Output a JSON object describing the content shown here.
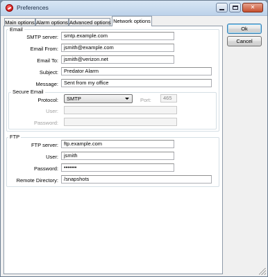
{
  "window": {
    "title": "Preferences"
  },
  "tabs": [
    "Main options",
    "Alarm options",
    "Advanced options",
    "Network options"
  ],
  "buttons": {
    "ok": "Ok",
    "cancel": "Cancel"
  },
  "email": {
    "group_label": "Email",
    "smtp_server_label": "SMTP server:",
    "smtp_server_value": "smtp.example.com",
    "email_from_label": "Email From:",
    "email_from_value": "jsmith@example.com",
    "email_to_label": "Email To:",
    "email_to_value": "jsmith@verizon.net",
    "subject_label": "Subject:",
    "subject_value": "Predator Alarm",
    "message_label": "Message:",
    "message_value": "Sent from my office"
  },
  "secure_email": {
    "group_label": "Secure Email",
    "protocol_label": "Protocol:",
    "protocol_value": "SMTP",
    "port_label": "Port:",
    "port_value": "465",
    "user_label": "User:",
    "user_value": "",
    "password_label": "Password:",
    "password_value": ""
  },
  "ftp": {
    "group_label": "FTP",
    "server_label": "FTP server:",
    "server_value": "ftp.example.com",
    "user_label": "User:",
    "user_value": "jsmith",
    "password_label": "Password:",
    "password_value": "•••••••",
    "remote_dir_label": "Remote Directory:",
    "remote_dir_value": "/snapshots"
  }
}
